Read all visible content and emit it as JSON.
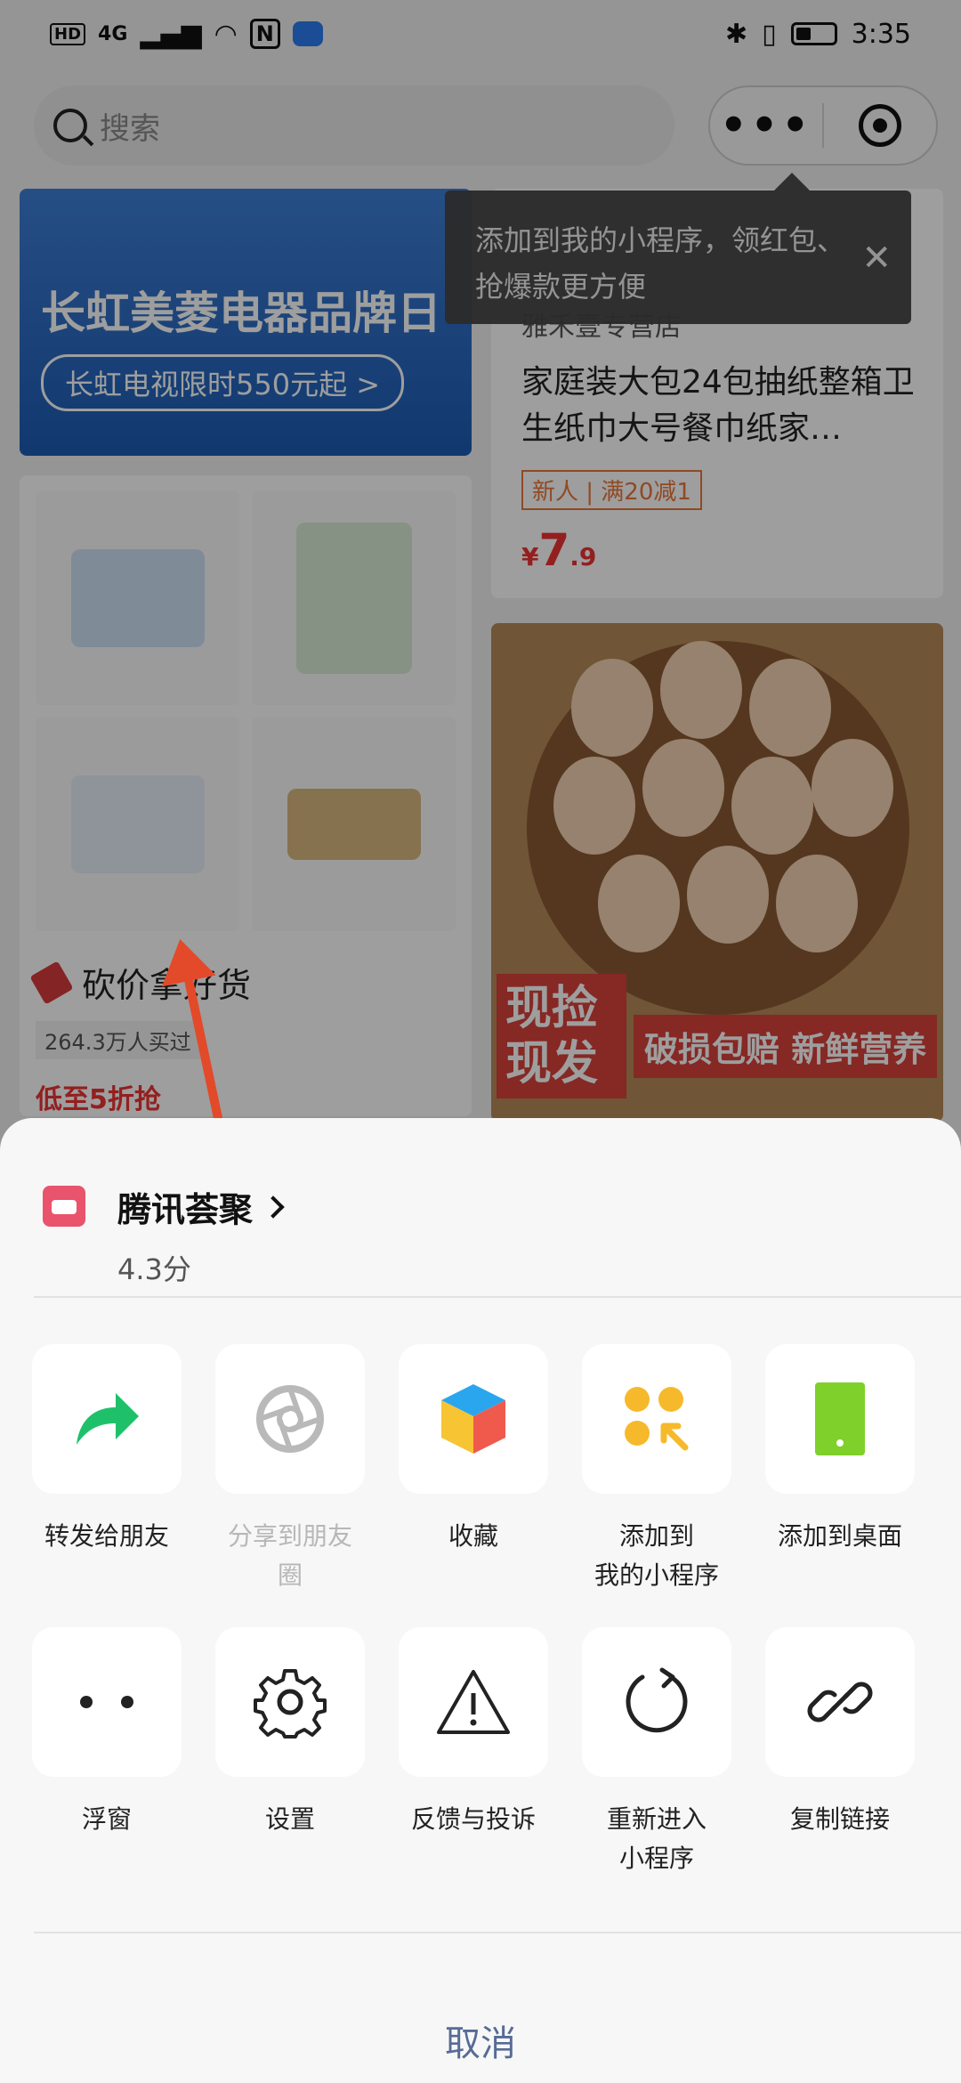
{
  "status_bar": {
    "network": "4G",
    "hd": "HD",
    "nfc": "N",
    "time": "3:35"
  },
  "search": {
    "placeholder": "搜索"
  },
  "banner": {
    "title": "长虹美菱电器品牌日",
    "pill": "长虹电视限时550元起  >"
  },
  "tooltip": {
    "text": "添加到我的小程序，领红包、抢爆款更方便"
  },
  "product_right": {
    "shop": "雅禾壹专营店",
    "title": "家庭装大包24包抽纸整箱卫生纸巾大号餐巾纸家…",
    "tag": "新人 | 满20减1",
    "price_symbol": "¥",
    "price_int": "7",
    "price_dec": ".9"
  },
  "product_left": {
    "deal_title": "砍价拿好货",
    "buyers": "264.3万人买过",
    "promo": "低至5折抢"
  },
  "egg_card": {
    "stamp": "现捡\n现发",
    "subtitle": "破损包赔 新鲜营养"
  },
  "sheet": {
    "app_name": "腾讯荟聚",
    "app_score": "4.3分",
    "row1": [
      {
        "label": "转发给朋友",
        "icon": "forward-arrow-icon",
        "muted": false
      },
      {
        "label": "分享到朋友\n圈",
        "icon": "aperture-icon",
        "muted": true
      },
      {
        "label": "收藏",
        "icon": "cube-icon",
        "muted": false
      },
      {
        "label": "添加到\n我的小程序",
        "icon": "mini-program-dots-icon",
        "muted": false
      },
      {
        "label": "添加到桌面",
        "icon": "phone-desktop-icon",
        "muted": false
      }
    ],
    "row2": [
      {
        "label": "浮窗",
        "icon": "float-window-icon"
      },
      {
        "label": "设置",
        "icon": "gear-icon"
      },
      {
        "label": "反馈与投诉",
        "icon": "warning-icon"
      },
      {
        "label": "重新进入\n小程序",
        "icon": "refresh-icon"
      },
      {
        "label": "复制链接",
        "icon": "link-icon"
      }
    ],
    "cancel": "取消"
  },
  "colors": {
    "accent_link": "#576b95",
    "forward_green": "#1ec16a",
    "overlay": "rgba(0,0,0,0.38)",
    "annotation_arrow": "#e24a2a"
  }
}
